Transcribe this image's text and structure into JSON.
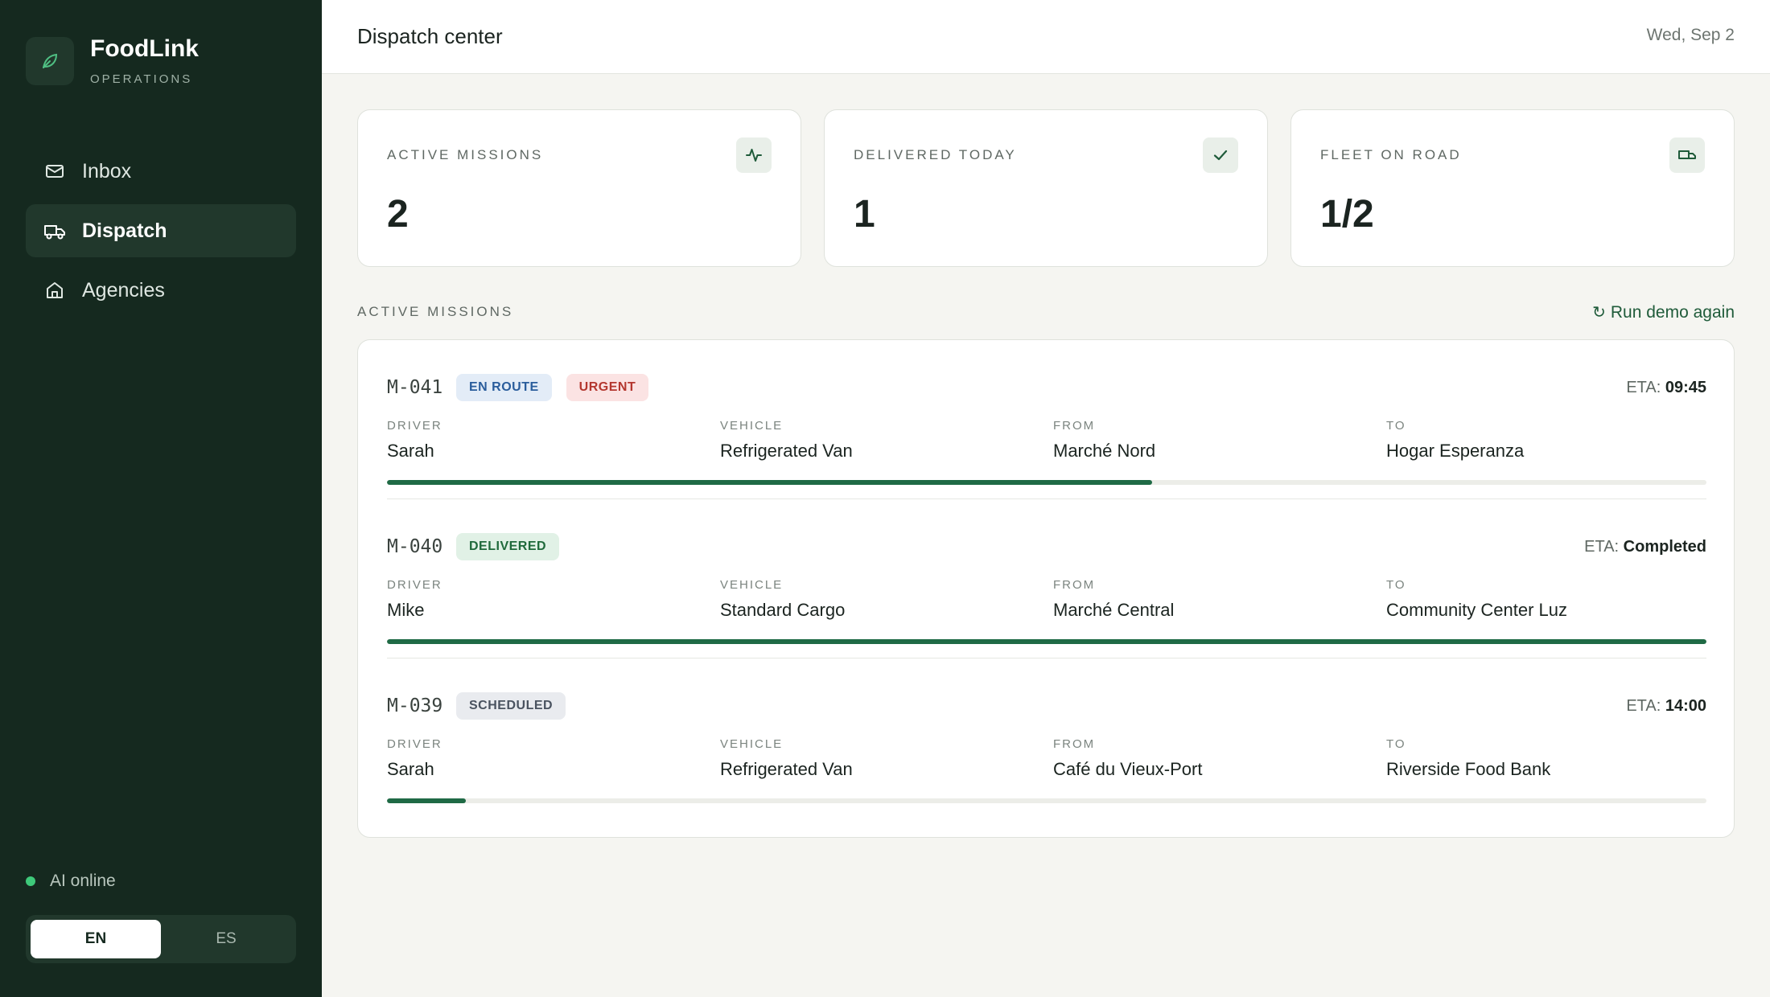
{
  "app": {
    "name": "FoodLink",
    "subtitle": "OPERATIONS"
  },
  "sidebar": {
    "items": [
      {
        "label": "Inbox",
        "icon": "mail-icon"
      },
      {
        "label": "Dispatch",
        "icon": "truck-icon",
        "active": true
      },
      {
        "label": "Agencies",
        "icon": "home-icon"
      }
    ],
    "status": "AI online",
    "languages": [
      {
        "label": "EN",
        "active": true
      },
      {
        "label": "ES",
        "active": false
      }
    ]
  },
  "header": {
    "title": "Dispatch center",
    "date": "Wed, Sep 2"
  },
  "stats": [
    {
      "label": "ACTIVE MISSIONS",
      "value": "2",
      "icon": "activity-icon"
    },
    {
      "label": "DELIVERED TODAY",
      "value": "1",
      "icon": "check-icon"
    },
    {
      "label": "FLEET ON ROAD",
      "value": "1/2",
      "icon": "truck-icon"
    }
  ],
  "missions_section": {
    "title": "ACTIVE MISSIONS",
    "action": "Run demo again",
    "action_icon": "↻"
  },
  "missions": [
    {
      "id": "M-041",
      "badges": [
        {
          "text": "EN ROUTE",
          "tone": "blue"
        },
        {
          "text": "URGENT",
          "tone": "red"
        }
      ],
      "eta_label": "ETA:",
      "eta": "09:45",
      "fields": [
        {
          "label": "DRIVER",
          "value": "Sarah"
        },
        {
          "label": "VEHICLE",
          "value": "Refrigerated Van"
        },
        {
          "label": "FROM",
          "value": "Marché Nord"
        },
        {
          "label": "TO",
          "value": "Hogar Esperanza"
        }
      ],
      "progress": 0.58
    },
    {
      "id": "M-040",
      "badges": [
        {
          "text": "DELIVERED",
          "tone": "green"
        }
      ],
      "eta_label": "ETA:",
      "eta": "Completed",
      "fields": [
        {
          "label": "DRIVER",
          "value": "Mike"
        },
        {
          "label": "VEHICLE",
          "value": "Standard Cargo"
        },
        {
          "label": "FROM",
          "value": "Marché Central"
        },
        {
          "label": "TO",
          "value": "Community Center Luz"
        }
      ],
      "progress": 1.0
    },
    {
      "id": "M-039",
      "badges": [
        {
          "text": "SCHEDULED",
          "tone": "gray"
        }
      ],
      "eta_label": "ETA:",
      "eta": "14:00",
      "fields": [
        {
          "label": "DRIVER",
          "value": "Sarah"
        },
        {
          "label": "VEHICLE",
          "value": "Refrigerated Van"
        },
        {
          "label": "FROM",
          "value": "Café du Vieux-Port"
        },
        {
          "label": "TO",
          "value": "Riverside Food Bank"
        }
      ],
      "progress": 0.06
    }
  ]
}
